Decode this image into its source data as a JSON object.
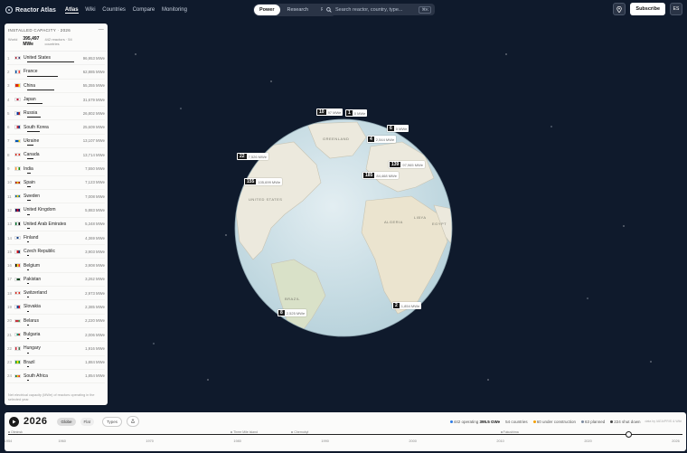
{
  "app": {
    "name": "Reactor Atlas"
  },
  "nav": {
    "items": [
      "Atlas",
      "Wiki",
      "Countries",
      "Compare",
      "Monitoring"
    ],
    "active": "Atlas"
  },
  "modes": {
    "items": [
      "Power",
      "Research",
      "Fuel"
    ],
    "active": "Power"
  },
  "search": {
    "placeholder": "Search reactor, country, type...",
    "shortcut": "⌘K"
  },
  "header_right": {
    "subscribe_label": "Subscribe",
    "lang": "ES"
  },
  "panel": {
    "title": "INSTALLED CAPACITY · 2026",
    "world_label": "World",
    "world_value": "395,497",
    "world_unit": "MWe",
    "countries_text": "442 reactors · 54 countries",
    "footnote": "Net electrical capacity (MWe) of reactors operating in the selected year.",
    "rows": [
      {
        "rank": "1",
        "name": "United States",
        "value": "96,953 MWe",
        "share": 1.0,
        "flag": [
          "#b22234",
          "#fff",
          "#3c3b6e"
        ]
      },
      {
        "rank": "2",
        "name": "France",
        "value": "62,885 MWe",
        "share": 0.65,
        "flag": [
          "#0055a4",
          "#fff",
          "#ef4135"
        ]
      },
      {
        "rank": "3",
        "name": "China",
        "value": "55,355 MWe",
        "share": 0.57,
        "flag": [
          "#de2910",
          "#de2910",
          "#ffde00"
        ]
      },
      {
        "rank": "4",
        "name": "Japan",
        "value": "31,679 MWe",
        "share": 0.33,
        "flag": [
          "#fff",
          "#bc002d",
          "#fff"
        ]
      },
      {
        "rank": "5",
        "name": "Russia",
        "value": "26,802 MWe",
        "share": 0.28,
        "flag": [
          "#fff",
          "#0039a6",
          "#d52b1e"
        ]
      },
      {
        "rank": "6",
        "name": "South Korea",
        "value": "25,609 MWe",
        "share": 0.26,
        "flag": [
          "#fff",
          "#cd2e3a",
          "#0047a0"
        ]
      },
      {
        "rank": "7",
        "name": "Ukraine",
        "value": "13,107 MWe",
        "share": 0.14,
        "flag": [
          "#0057b7",
          "#0057b7",
          "#ffd700"
        ]
      },
      {
        "rank": "8",
        "name": "Canada",
        "value": "13,714 MWe",
        "share": 0.14,
        "flag": [
          "#d52b1e",
          "#fff",
          "#d52b1e"
        ]
      },
      {
        "rank": "9",
        "name": "India",
        "value": "7,550 MWe",
        "share": 0.08,
        "flag": [
          "#ff9933",
          "#fff",
          "#138808"
        ]
      },
      {
        "rank": "10",
        "name": "Spain",
        "value": "7,123 MWe",
        "share": 0.07,
        "flag": [
          "#aa151b",
          "#f1bf00",
          "#aa151b"
        ]
      },
      {
        "rank": "11",
        "name": "Sweden",
        "value": "7,008 MWe",
        "share": 0.07,
        "flag": [
          "#006aa7",
          "#fecc00",
          "#006aa7"
        ]
      },
      {
        "rank": "12",
        "name": "United Kingdom",
        "value": "5,883 MWe",
        "share": 0.06,
        "flag": [
          "#012169",
          "#c8102e",
          "#012169"
        ]
      },
      {
        "rank": "13",
        "name": "United Arab Emirates",
        "value": "5,348 MWe",
        "share": 0.055,
        "flag": [
          "#00732f",
          "#fff",
          "#000"
        ]
      },
      {
        "rank": "14",
        "name": "Finland",
        "value": "4,369 MWe",
        "share": 0.045,
        "flag": [
          "#fff",
          "#003580",
          "#fff"
        ]
      },
      {
        "rank": "15",
        "name": "Czech Republic",
        "value": "3,903 MWe",
        "share": 0.04,
        "flag": [
          "#fff",
          "#d7141a",
          "#11457e"
        ]
      },
      {
        "rank": "16",
        "name": "Belgium",
        "value": "3,908 MWe",
        "share": 0.04,
        "flag": [
          "#000",
          "#fdda24",
          "#ef3340"
        ]
      },
      {
        "rank": "17",
        "name": "Pakistan",
        "value": "3,262 MWe",
        "share": 0.034,
        "flag": [
          "#fff",
          "#01411c",
          "#01411c"
        ]
      },
      {
        "rank": "18",
        "name": "Switzerland",
        "value": "2,973 MWe",
        "share": 0.031,
        "flag": [
          "#d52b1e",
          "#fff",
          "#d52b1e"
        ]
      },
      {
        "rank": "19",
        "name": "Slovakia",
        "value": "2,385 MWe",
        "share": 0.025,
        "flag": [
          "#fff",
          "#0b4ea2",
          "#ee1c25"
        ]
      },
      {
        "rank": "20",
        "name": "Belarus",
        "value": "2,220 MWe",
        "share": 0.023,
        "flag": [
          "#c8313e",
          "#c8313e",
          "#4aa657"
        ]
      },
      {
        "rank": "21",
        "name": "Bulgaria",
        "value": "2,006 MWe",
        "share": 0.021,
        "flag": [
          "#fff",
          "#00966e",
          "#d62612"
        ]
      },
      {
        "rank": "22",
        "name": "Hungary",
        "value": "1,916 MWe",
        "share": 0.02,
        "flag": [
          "#ce2939",
          "#fff",
          "#477050"
        ]
      },
      {
        "rank": "23",
        "name": "Brazil",
        "value": "1,884 MWe",
        "share": 0.019,
        "flag": [
          "#009c3b",
          "#ffdf00",
          "#009c3b"
        ]
      },
      {
        "rank": "24",
        "name": "South Africa",
        "value": "1,854 MWe",
        "share": 0.019,
        "flag": [
          "#007a4d",
          "#ffb612",
          "#de3831"
        ]
      }
    ]
  },
  "globe": {
    "land_labels": [
      "GREENLAND",
      "UNITED STATES",
      "BRAZIL",
      "LIBYA",
      "ALGERIA",
      "EGYPT"
    ],
    "markers": [
      {
        "count": "10",
        "value": "97 MWe"
      },
      {
        "count": "1",
        "value": "0 MWe"
      },
      {
        "count": "6",
        "value": "0 MWe"
      },
      {
        "count": "4",
        "value": "2,544 MWe"
      },
      {
        "count": "22",
        "value": "7,526 MWe"
      },
      {
        "count": "139",
        "value": "97,965 MWe"
      },
      {
        "count": "185",
        "value": "84,468 MWe"
      },
      {
        "count": "155",
        "value": "105,699 MWe"
      },
      {
        "count": "8",
        "value": "2,525 MWe"
      },
      {
        "count": "2",
        "value": "1,854 MWe"
      }
    ]
  },
  "timeline": {
    "year": "2026",
    "chips": [
      "Globe",
      "Flat"
    ],
    "chip_selected": "Globe",
    "types_label": "Types",
    "stats": [
      {
        "text": "442 operating",
        "strong": "395.5 GWe",
        "color": "#2c7be5"
      },
      {
        "text": "54 countries",
        "strong": "",
        "color": ""
      },
      {
        "text": "60 under construction",
        "strong": "",
        "color": "#f59f00"
      },
      {
        "text": "63 planned",
        "strong": "",
        "color": "#7c8aa0"
      },
      {
        "text": "224 shut down",
        "strong": "",
        "color": "#444"
      }
    ],
    "credit": "data by IAEA/PRIS & Wiki",
    "events": [
      "Obninsk",
      "Three Mile Island",
      "Chernobyl",
      "Fukushima"
    ],
    "ticks": [
      "1954",
      "1960",
      "1970",
      "1980",
      "1990",
      "2000",
      "2010",
      "2020",
      "2026"
    ],
    "progress": 0.92
  }
}
